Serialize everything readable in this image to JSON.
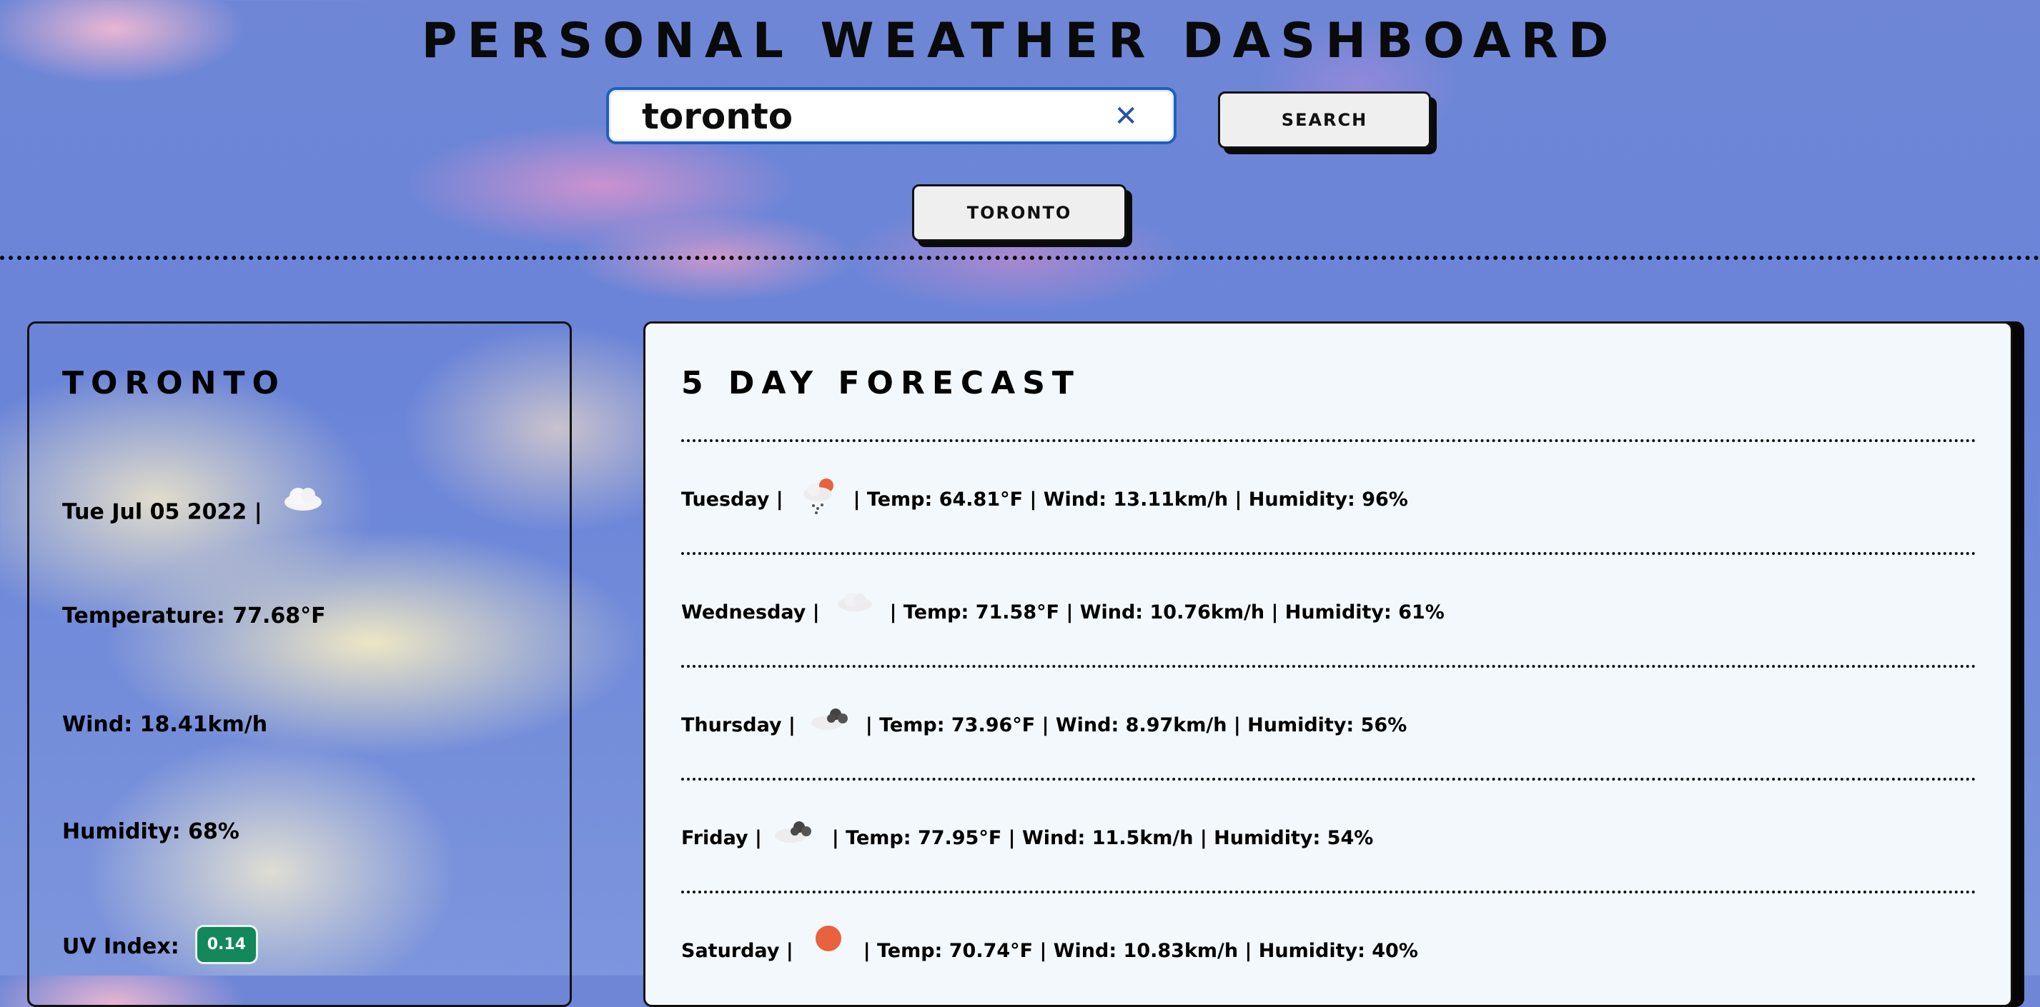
{
  "header": {
    "title": "PERSONAL WEATHER DASHBOARD"
  },
  "search": {
    "value": "toronto",
    "button_label": "SEARCH",
    "clear_symbol": "✕"
  },
  "history": [
    {
      "label": "TORONTO"
    }
  ],
  "current": {
    "city": "TORONTO",
    "date": "Tue Jul 05 2022 |",
    "icon": "cloud-icon",
    "temperature": "Temperature: 77.68°F",
    "wind": "Wind: 18.41km/h",
    "humidity": "Humidity: 68%",
    "uv_label": "UV Index:",
    "uv_value": "0.14",
    "uv_color": "#13885a"
  },
  "forecast": {
    "title": "5 DAY FORECAST",
    "days": [
      {
        "day": "Tuesday |",
        "icon": "sun-cloud-rain-icon",
        "details": "| Temp: 64.81°F | Wind: 13.11km/h | Humidity: 96%"
      },
      {
        "day": "Wednesday |",
        "icon": "cloud-icon",
        "details": "| Temp: 71.58°F | Wind: 10.76km/h | Humidity: 61%"
      },
      {
        "day": "Thursday |",
        "icon": "broken-clouds-icon",
        "details": "| Temp: 73.96°F | Wind: 8.97km/h | Humidity: 56%"
      },
      {
        "day": "Friday |",
        "icon": "broken-clouds-icon",
        "details": "| Temp: 77.95°F | Wind: 11.5km/h | Humidity: 54%"
      },
      {
        "day": "Saturday |",
        "icon": "sun-icon",
        "details": "| Temp: 70.74°F | Wind: 10.83km/h | Humidity: 40%"
      }
    ]
  },
  "colors": {
    "accent": "#1f5fbf",
    "sun": "#e8623e",
    "panel_bg": "#f3f8fc"
  }
}
